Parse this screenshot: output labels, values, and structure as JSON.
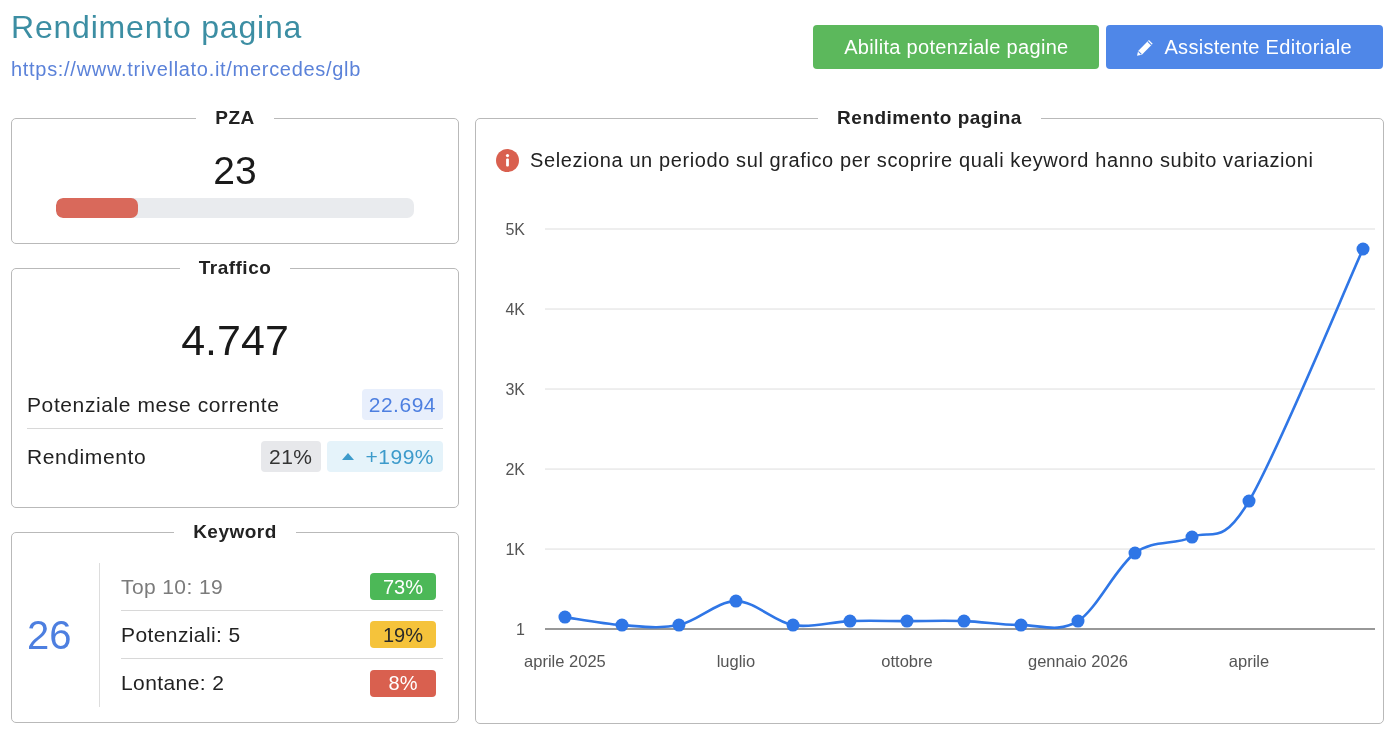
{
  "header": {
    "title": "Rendimento pagina",
    "url": "https://www.trivellato.it/mercedes/glb"
  },
  "buttons": [
    {
      "label": "Abilita potenziale pagine",
      "kind": "success"
    },
    {
      "label": "Assistente Editoriale",
      "kind": "primary"
    }
  ],
  "pza": {
    "title": "PZA",
    "value": "23",
    "level": 0.23
  },
  "traffic": {
    "title": "Traffico",
    "value": "4.747",
    "rows": [
      {
        "label": "Potenziale mese corrente",
        "badges": [
          {
            "text": "22.694",
            "kind": "info"
          }
        ]
      },
      {
        "label": "Rendimento",
        "badges": [
          {
            "text": "21%",
            "kind": "neutral"
          },
          {
            "text": "+199%",
            "kind": "trend-up"
          }
        ]
      }
    ]
  },
  "keyword": {
    "title": "Keyword",
    "total": "26",
    "rows": [
      {
        "label": "Top 10: 19",
        "dimmed": true,
        "percent": "73%",
        "color": "#4cb857"
      },
      {
        "label": "Potenziali: 5",
        "dimmed": false,
        "percent": "19%",
        "color": "#f5c33b"
      },
      {
        "label": "Lontane: 2",
        "dimmed": false,
        "percent": "8%",
        "color": "#d9604f"
      }
    ]
  },
  "performance": {
    "title": "Rendimento pagina",
    "notice": "Seleziona un periodo sul grafico per scoprire quali keyword hanno subito variazioni",
    "chart_data": {
      "type": "line",
      "grid": true,
      "categories": [
        "aprile 2025",
        null,
        null,
        "luglio",
        null,
        null,
        "ottobre",
        null,
        null,
        "gennaio 2026",
        null,
        null,
        "aprile",
        null,
        null
      ],
      "series": [
        {
          "color": "#2f76e6",
          "marker": true,
          "values": [
            150,
            50,
            50,
            350,
            50,
            100,
            100,
            100,
            50,
            100,
            950,
            1150,
            1600,
            null,
            4750
          ]
        }
      ],
      "ylim": [
        1,
        5000
      ],
      "yticks": [
        {
          "value": 1,
          "label": "1"
        },
        {
          "value": 1000,
          "label": "1K"
        },
        {
          "value": 2000,
          "label": "2K"
        },
        {
          "value": 3000,
          "label": "3K"
        },
        {
          "value": 4000,
          "label": "4K"
        },
        {
          "value": 5000,
          "label": "5K"
        }
      ]
    }
  }
}
